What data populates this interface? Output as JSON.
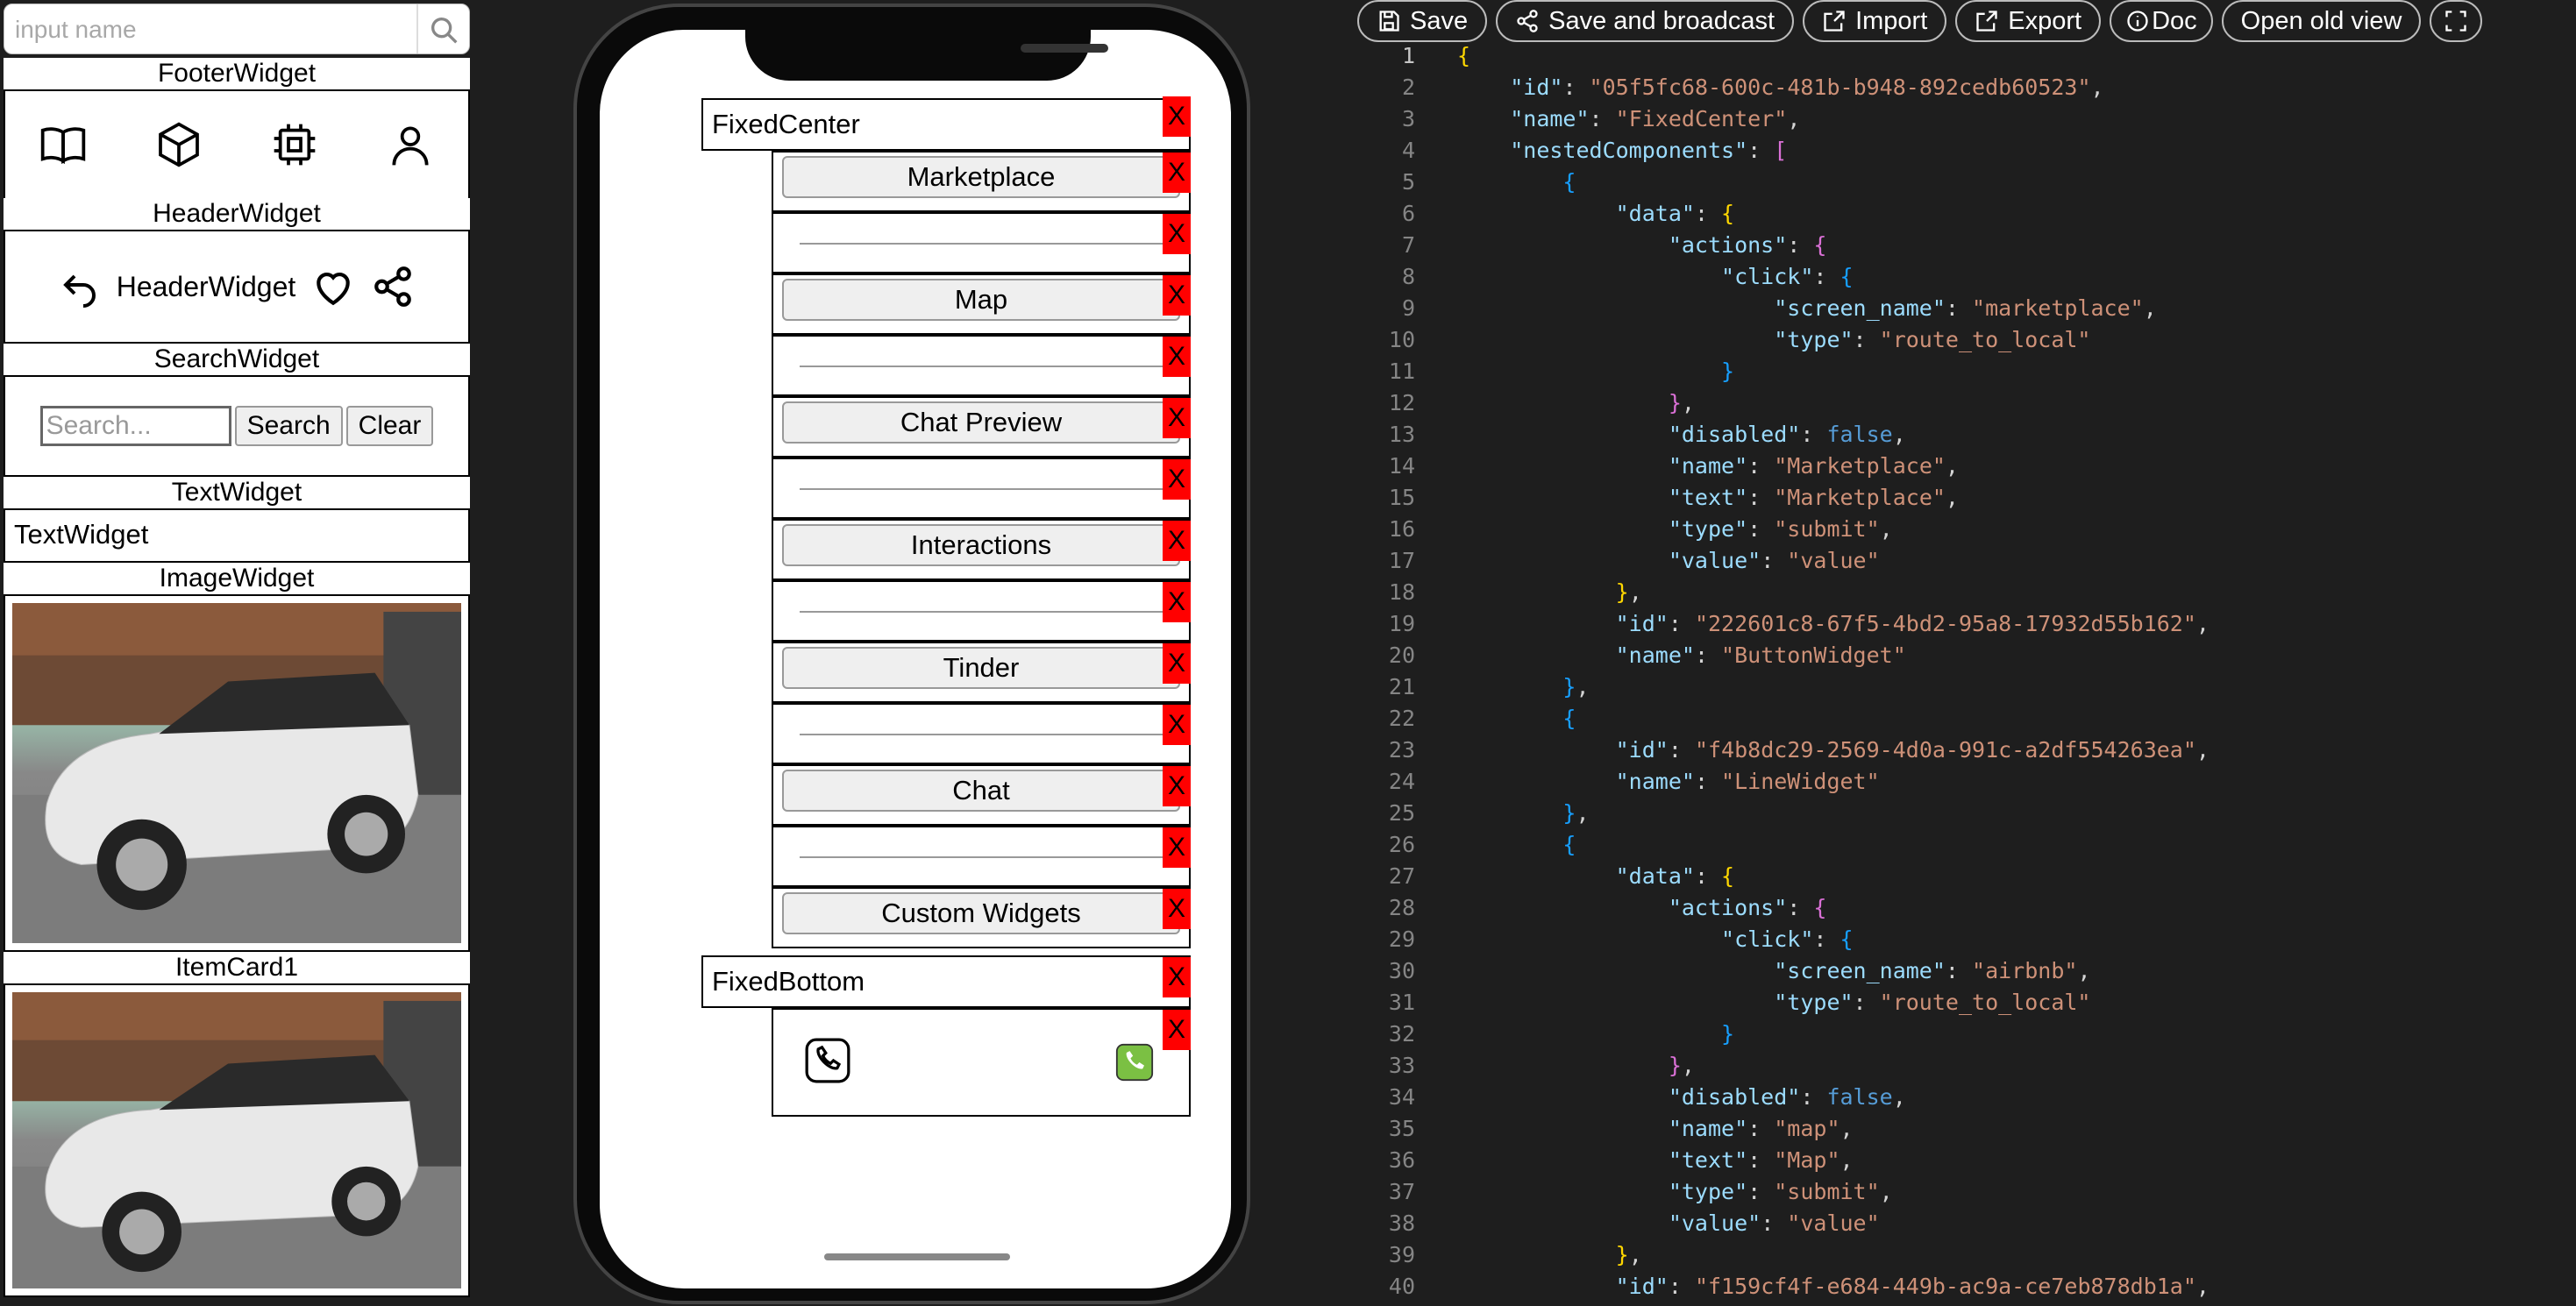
{
  "sidebar": {
    "search_placeholder": "input name",
    "footer_title": "FooterWidget",
    "header_title": "HeaderWidget",
    "header_text": "HeaderWidget",
    "search_title": "SearchWidget",
    "search_placeholder_widget": "Search...",
    "search_button": "Search",
    "clear_button": "Clear",
    "text_title": "TextWidget",
    "text_value": "TextWidget",
    "image_title": "ImageWidget",
    "itemcard_title": "ItemCard1",
    "icons": [
      "book-icon",
      "cube-icon",
      "chip-icon",
      "user-icon"
    ]
  },
  "phone": {
    "fixed_center": "FixedCenter",
    "fixed_bottom": "FixedBottom",
    "x_label": "X",
    "buttons": [
      "Marketplace",
      "Map",
      "Chat Preview",
      "Interactions",
      "Tinder",
      "Chat",
      "Custom Widgets"
    ]
  },
  "toolbar": {
    "save": "Save",
    "save_broadcast": "Save and broadcast",
    "import": "Import",
    "export": "Export",
    "doc": "Doc",
    "open_old": "Open old view"
  },
  "code": {
    "lines": [
      [
        [
          "p1",
          "{"
        ]
      ],
      [
        [
          "t",
          "    "
        ],
        [
          "k",
          "\"id\""
        ],
        [
          "t",
          ": "
        ],
        [
          "s",
          "\"05f5fc68-600c-481b-b948-892cedb60523\""
        ],
        [
          "t",
          ","
        ]
      ],
      [
        [
          "t",
          "    "
        ],
        [
          "k",
          "\"name\""
        ],
        [
          "t",
          ": "
        ],
        [
          "s",
          "\"FixedCenter\""
        ],
        [
          "t",
          ","
        ]
      ],
      [
        [
          "t",
          "    "
        ],
        [
          "k",
          "\"nestedComponents\""
        ],
        [
          "t",
          ": "
        ],
        [
          "p2",
          "["
        ]
      ],
      [
        [
          "t",
          "        "
        ],
        [
          "p3",
          "{"
        ]
      ],
      [
        [
          "t",
          "            "
        ],
        [
          "k",
          "\"data\""
        ],
        [
          "t",
          ": "
        ],
        [
          "p1",
          "{"
        ]
      ],
      [
        [
          "t",
          "                "
        ],
        [
          "k",
          "\"actions\""
        ],
        [
          "t",
          ": "
        ],
        [
          "p2",
          "{"
        ]
      ],
      [
        [
          "t",
          "                    "
        ],
        [
          "k",
          "\"click\""
        ],
        [
          "t",
          ": "
        ],
        [
          "p3",
          "{"
        ]
      ],
      [
        [
          "t",
          "                        "
        ],
        [
          "k",
          "\"screen_name\""
        ],
        [
          "t",
          ": "
        ],
        [
          "s",
          "\"marketplace\""
        ],
        [
          "t",
          ","
        ]
      ],
      [
        [
          "t",
          "                        "
        ],
        [
          "k",
          "\"type\""
        ],
        [
          "t",
          ": "
        ],
        [
          "s",
          "\"route_to_local\""
        ]
      ],
      [
        [
          "t",
          "                    "
        ],
        [
          "p3",
          "}"
        ]
      ],
      [
        [
          "t",
          "                "
        ],
        [
          "p2",
          "}"
        ],
        [
          "t",
          ","
        ]
      ],
      [
        [
          "t",
          "                "
        ],
        [
          "k",
          "\"disabled\""
        ],
        [
          "t",
          ": "
        ],
        [
          "b",
          "false"
        ],
        [
          "t",
          ","
        ]
      ],
      [
        [
          "t",
          "                "
        ],
        [
          "k",
          "\"name\""
        ],
        [
          "t",
          ": "
        ],
        [
          "s",
          "\"Marketplace\""
        ],
        [
          "t",
          ","
        ]
      ],
      [
        [
          "t",
          "                "
        ],
        [
          "k",
          "\"text\""
        ],
        [
          "t",
          ": "
        ],
        [
          "s",
          "\"Marketplace\""
        ],
        [
          "t",
          ","
        ]
      ],
      [
        [
          "t",
          "                "
        ],
        [
          "k",
          "\"type\""
        ],
        [
          "t",
          ": "
        ],
        [
          "s",
          "\"submit\""
        ],
        [
          "t",
          ","
        ]
      ],
      [
        [
          "t",
          "                "
        ],
        [
          "k",
          "\"value\""
        ],
        [
          "t",
          ": "
        ],
        [
          "s",
          "\"value\""
        ]
      ],
      [
        [
          "t",
          "            "
        ],
        [
          "p1",
          "}"
        ],
        [
          "t",
          ","
        ]
      ],
      [
        [
          "t",
          "            "
        ],
        [
          "k",
          "\"id\""
        ],
        [
          "t",
          ": "
        ],
        [
          "s",
          "\"222601c8-67f5-4bd2-95a8-17932d55b162\""
        ],
        [
          "t",
          ","
        ]
      ],
      [
        [
          "t",
          "            "
        ],
        [
          "k",
          "\"name\""
        ],
        [
          "t",
          ": "
        ],
        [
          "s",
          "\"ButtonWidget\""
        ]
      ],
      [
        [
          "t",
          "        "
        ],
        [
          "p3",
          "}"
        ],
        [
          "t",
          ","
        ]
      ],
      [
        [
          "t",
          "        "
        ],
        [
          "p3",
          "{"
        ]
      ],
      [
        [
          "t",
          "            "
        ],
        [
          "k",
          "\"id\""
        ],
        [
          "t",
          ": "
        ],
        [
          "s",
          "\"f4b8dc29-2569-4d0a-991c-a2df554263ea\""
        ],
        [
          "t",
          ","
        ]
      ],
      [
        [
          "t",
          "            "
        ],
        [
          "k",
          "\"name\""
        ],
        [
          "t",
          ": "
        ],
        [
          "s",
          "\"LineWidget\""
        ]
      ],
      [
        [
          "t",
          "        "
        ],
        [
          "p3",
          "}"
        ],
        [
          "t",
          ","
        ]
      ],
      [
        [
          "t",
          "        "
        ],
        [
          "p3",
          "{"
        ]
      ],
      [
        [
          "t",
          "            "
        ],
        [
          "k",
          "\"data\""
        ],
        [
          "t",
          ": "
        ],
        [
          "p1",
          "{"
        ]
      ],
      [
        [
          "t",
          "                "
        ],
        [
          "k",
          "\"actions\""
        ],
        [
          "t",
          ": "
        ],
        [
          "p2",
          "{"
        ]
      ],
      [
        [
          "t",
          "                    "
        ],
        [
          "k",
          "\"click\""
        ],
        [
          "t",
          ": "
        ],
        [
          "p3",
          "{"
        ]
      ],
      [
        [
          "t",
          "                        "
        ],
        [
          "k",
          "\"screen_name\""
        ],
        [
          "t",
          ": "
        ],
        [
          "s",
          "\"airbnb\""
        ],
        [
          "t",
          ","
        ]
      ],
      [
        [
          "t",
          "                        "
        ],
        [
          "k",
          "\"type\""
        ],
        [
          "t",
          ": "
        ],
        [
          "s",
          "\"route_to_local\""
        ]
      ],
      [
        [
          "t",
          "                    "
        ],
        [
          "p3",
          "}"
        ]
      ],
      [
        [
          "t",
          "                "
        ],
        [
          "p2",
          "}"
        ],
        [
          "t",
          ","
        ]
      ],
      [
        [
          "t",
          "                "
        ],
        [
          "k",
          "\"disabled\""
        ],
        [
          "t",
          ": "
        ],
        [
          "b",
          "false"
        ],
        [
          "t",
          ","
        ]
      ],
      [
        [
          "t",
          "                "
        ],
        [
          "k",
          "\"name\""
        ],
        [
          "t",
          ": "
        ],
        [
          "s",
          "\"map\""
        ],
        [
          "t",
          ","
        ]
      ],
      [
        [
          "t",
          "                "
        ],
        [
          "k",
          "\"text\""
        ],
        [
          "t",
          ": "
        ],
        [
          "s",
          "\"Map\""
        ],
        [
          "t",
          ","
        ]
      ],
      [
        [
          "t",
          "                "
        ],
        [
          "k",
          "\"type\""
        ],
        [
          "t",
          ": "
        ],
        [
          "s",
          "\"submit\""
        ],
        [
          "t",
          ","
        ]
      ],
      [
        [
          "t",
          "                "
        ],
        [
          "k",
          "\"value\""
        ],
        [
          "t",
          ": "
        ],
        [
          "s",
          "\"value\""
        ]
      ],
      [
        [
          "t",
          "            "
        ],
        [
          "p1",
          "}"
        ],
        [
          "t",
          ","
        ]
      ],
      [
        [
          "t",
          "            "
        ],
        [
          "k",
          "\"id\""
        ],
        [
          "t",
          ": "
        ],
        [
          "s",
          "\"f159cf4f-e684-449b-ac9a-ce7eb878db1a\""
        ],
        [
          "t",
          ","
        ]
      ]
    ]
  }
}
